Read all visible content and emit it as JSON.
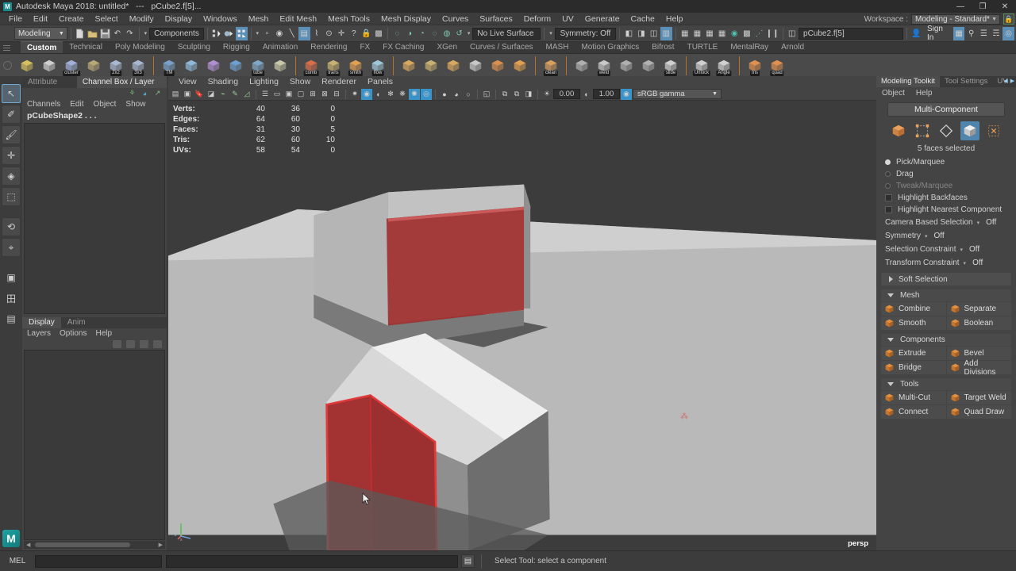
{
  "titlebar": {
    "logo": "M",
    "title": "Autodesk Maya 2018: untitled*   ---   pCube2.f[5]...",
    "minimize": "—",
    "maximize": "❐",
    "close": "✕"
  },
  "menubar": {
    "items": [
      "File",
      "Edit",
      "Create",
      "Select",
      "Modify",
      "Display",
      "Windows",
      "Mesh",
      "Edit Mesh",
      "Mesh Tools",
      "Mesh Display",
      "Curves",
      "Surfaces",
      "Deform",
      "UV",
      "Generate",
      "Cache",
      "Help"
    ],
    "workspace_label": "Workspace :",
    "workspace_value": "Modeling - Standard*",
    "lock_icon": "lock-icon"
  },
  "statusbar": {
    "mode": "Modeling",
    "new_icon": "new-scene-icon",
    "open_icon": "open-scene-icon",
    "save_icon": "save-scene-icon",
    "undo_icon": "undo-icon",
    "redo_icon": "redo-icon",
    "selection_mask": "Components",
    "live_surface": "No Live Surface",
    "symmetry": "Symmetry: Off",
    "input_field": "pCube2.f[5]",
    "sign_in": "Sign In",
    "select_hierarchy_icon": "select-hierarchy-icon",
    "select_object_icon": "select-object-icon",
    "select_component_icon": "select-component-icon"
  },
  "shelf": {
    "tabs": [
      "Custom",
      "Technical",
      "Poly Modeling",
      "Sculpting",
      "Rigging",
      "Animation",
      "Rendering",
      "FX",
      "FX Caching",
      "XGen",
      "Curves / Surfaces",
      "MASH",
      "Motion Graphics",
      "Bifrost",
      "TURTLE",
      "MentalRay",
      "Arnold"
    ],
    "active_tab": "Custom",
    "icons": [
      {
        "name": "target-icon",
        "tag": ""
      },
      {
        "name": "snowflake-icon",
        "tag": ""
      },
      {
        "name": "cluster-icon",
        "tag": "cluster"
      },
      {
        "name": "lattice-icon",
        "tag": ""
      },
      {
        "name": "grid-2x2-icon",
        "tag": "2x2"
      },
      {
        "name": "grid-3x3-icon",
        "tag": "3x3"
      },
      {
        "name": "texture-map-icon",
        "tag": "TM"
      },
      {
        "name": "paint-brush-icon",
        "tag": ""
      },
      {
        "name": "hair-icon",
        "tag": ""
      },
      {
        "name": "cloth-icon",
        "tag": ""
      },
      {
        "name": "tube-icon",
        "tag": "tube"
      },
      {
        "name": "curve-icon",
        "tag": ""
      },
      {
        "name": "comb-icon",
        "tag": "comb"
      },
      {
        "name": "transfer-icon",
        "tag": "trans"
      },
      {
        "name": "smith-icon",
        "tag": "smith"
      },
      {
        "name": "flow-icon",
        "tag": "flow"
      },
      {
        "name": "deform-icon",
        "tag": ""
      },
      {
        "name": "layers-icon",
        "tag": ""
      },
      {
        "name": "stack-icon",
        "tag": ""
      },
      {
        "name": "scatter-icon",
        "tag": ""
      },
      {
        "name": "crate-icon",
        "tag": ""
      },
      {
        "name": "sphere-icon",
        "tag": ""
      },
      {
        "name": "clean-icon",
        "tag": "clean"
      },
      {
        "name": "transform-icon",
        "tag": ""
      },
      {
        "name": "weld-icon",
        "tag": "weld"
      },
      {
        "name": "quad-grid-icon",
        "tag": ""
      },
      {
        "name": "edge-loop-icon",
        "tag": ""
      },
      {
        "name": "slide-icon",
        "tag": "slide"
      },
      {
        "name": "unlock-icon",
        "tag": "Unlock"
      },
      {
        "name": "angle-icon",
        "tag": "Angle"
      },
      {
        "name": "tris-icon",
        "tag": "tris"
      },
      {
        "name": "quad-icon",
        "tag": "quad"
      }
    ]
  },
  "toolbox": {
    "items": [
      {
        "name": "select-tool",
        "glyph": "↖",
        "selected": true
      },
      {
        "name": "lasso-tool",
        "glyph": "✐",
        "selected": false
      },
      {
        "name": "paint-select-tool",
        "glyph": "🖌",
        "selected": false
      },
      {
        "name": "move-tool",
        "glyph": "✛",
        "selected": false
      },
      {
        "name": "rotate-tool",
        "glyph": "◈",
        "selected": false
      },
      {
        "name": "scale-tool",
        "glyph": "⬚",
        "selected": false
      },
      {
        "name": "last-tool",
        "glyph": "⟲",
        "selected": false
      },
      {
        "name": "snap-tool",
        "glyph": "⌖",
        "selected": false
      },
      {
        "name": "layout-single-icon",
        "glyph": "▣",
        "selected": false
      },
      {
        "name": "layout-four-icon",
        "glyph": "田",
        "selected": false
      },
      {
        "name": "layout-outliner-icon",
        "glyph": "▤",
        "selected": false
      }
    ],
    "badge": "M"
  },
  "left_panel": {
    "tabs": [
      "Attribute Editor",
      "Channel Box / Layer Editor"
    ],
    "active_tab": "Channel Box / Layer Editor",
    "channel_menu": [
      "Channels",
      "Edit",
      "Object",
      "Show"
    ],
    "object_name": "pCubeShape2 . . .",
    "icons": [
      "connection-editor-icon",
      "sphere-icon",
      "graph-editor-icon"
    ],
    "layer_tabs": [
      "Display",
      "Anim"
    ],
    "active_layer_tab": "Display",
    "layer_menu": [
      "Layers",
      "Options",
      "Help"
    ]
  },
  "viewport": {
    "menus": [
      "View",
      "Shading",
      "Lighting",
      "Show",
      "Renderer",
      "Panels"
    ],
    "exposure": "0.00",
    "gamma": "1.00",
    "color_space": "sRGB gamma",
    "camera_label": "persp",
    "hud": {
      "columns": 3,
      "rows": [
        {
          "label": "Verts:",
          "values": [
            "40",
            "36",
            "0"
          ]
        },
        {
          "label": "Edges:",
          "values": [
            "64",
            "60",
            "0"
          ]
        },
        {
          "label": "Faces:",
          "values": [
            "31",
            "30",
            "5"
          ]
        },
        {
          "label": "Tris:",
          "values": [
            "62",
            "60",
            "10"
          ]
        },
        {
          "label": "UVs:",
          "values": [
            "58",
            "54",
            "0"
          ]
        }
      ]
    }
  },
  "right_panel": {
    "tabs": [
      "Modeling Toolkit",
      "Tool Settings",
      "UV"
    ],
    "active_tab": "Modeling Toolkit",
    "menu": [
      "Object",
      "Help"
    ],
    "multi_component_label": "Multi-Component",
    "component_buttons": [
      {
        "name": "object-mode-icon",
        "selected": false
      },
      {
        "name": "vertex-mode-icon",
        "selected": false
      },
      {
        "name": "edge-mode-icon",
        "selected": false
      },
      {
        "name": "face-mode-icon",
        "selected": true
      },
      {
        "name": "uv-mode-icon",
        "selected": false
      }
    ],
    "selection_count": "5 faces selected",
    "radios": [
      {
        "label": "Pick/Marquee",
        "selected": true,
        "dim": false
      },
      {
        "label": "Drag",
        "selected": false,
        "dim": false
      },
      {
        "label": "Tweak/Marquee",
        "selected": false,
        "dim": true
      }
    ],
    "checkboxes": [
      {
        "label": "Highlight Backfaces",
        "checked": false
      },
      {
        "label": "Highlight Nearest Component",
        "checked": false
      }
    ],
    "options": [
      {
        "label": "Camera Based Selection",
        "value": "Off"
      },
      {
        "label": "Symmetry",
        "value": "Off"
      },
      {
        "label": "Selection Constraint",
        "value": "Off"
      },
      {
        "label": "Transform Constraint",
        "value": "Off"
      }
    ],
    "soft_selection": "Soft Selection",
    "sections": [
      {
        "title": "Mesh",
        "buttons": [
          {
            "label": "Combine",
            "icon": "combine-icon"
          },
          {
            "label": "Separate",
            "icon": "separate-icon"
          },
          {
            "label": "Smooth",
            "icon": "smooth-icon"
          },
          {
            "label": "Boolean",
            "icon": "boolean-icon"
          }
        ]
      },
      {
        "title": "Components",
        "buttons": [
          {
            "label": "Extrude",
            "icon": "extrude-icon"
          },
          {
            "label": "Bevel",
            "icon": "bevel-icon"
          },
          {
            "label": "Bridge",
            "icon": "bridge-icon"
          },
          {
            "label": "Add Divisions",
            "icon": "add-divisions-icon"
          }
        ]
      },
      {
        "title": "Tools",
        "buttons": [
          {
            "label": "Multi-Cut",
            "icon": "multi-cut-icon"
          },
          {
            "label": "Target Weld",
            "icon": "target-weld-icon"
          },
          {
            "label": "Connect",
            "icon": "connect-icon"
          },
          {
            "label": "Quad Draw",
            "icon": "quad-draw-icon"
          }
        ]
      }
    ]
  },
  "bottombar": {
    "mel_label": "MEL",
    "command_input": "",
    "script_editor_icon": "script-editor-icon",
    "help_line": "Select Tool: select a component"
  },
  "colors": {
    "accent_blue": "#5c8fb5",
    "accent_orange": "#e0873a",
    "selection_red": "#c24040",
    "panel_bg": "#444444",
    "dark_bg": "#2b2b2b"
  }
}
